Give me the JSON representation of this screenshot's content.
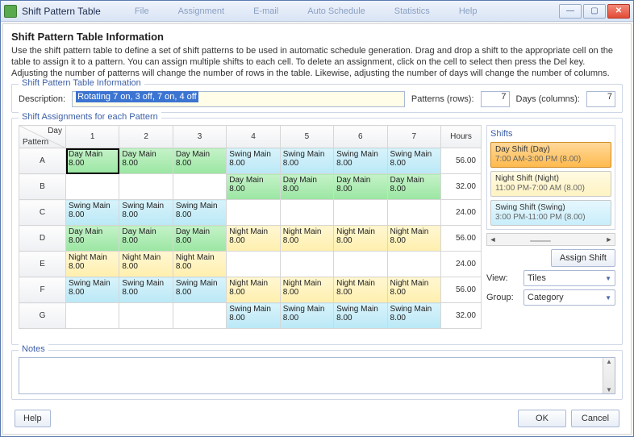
{
  "window": {
    "title": "Shift Pattern Table"
  },
  "menu_hints": [
    "File",
    "Assignment",
    "E-mail",
    "Auto Schedule",
    "Statistics",
    "Help"
  ],
  "heading": "Shift Pattern Table Information",
  "intro": "Use the shift pattern table to define a set of shift patterns to be used in automatic schedule generation. Drag and drop a shift to the appropriate cell on the table to assign it to a pattern. You can assign multiple shifts to each cell. To delete an assignment, click on the cell to select then press the Del key.  Adjusting the number of patterns will change the number of rows in the table. Likewise, adjusting the number of days will change the number of columns.",
  "info_box": {
    "legend": "Shift Pattern Table Information",
    "description_label": "Description:",
    "description_value": "Rotating 7 on, 3 off, 7 on, 4 off",
    "patterns_label": "Patterns (rows):",
    "patterns_value": "7",
    "days_label": "Days (columns):",
    "days_value": "7"
  },
  "assignments": {
    "legend": "Shift Assignments for each Pattern",
    "corner_day": "Day",
    "corner_pattern": "Pattern",
    "day_headers": [
      "1",
      "2",
      "3",
      "4",
      "5",
      "6",
      "7"
    ],
    "hours_header": "Hours",
    "rows": [
      {
        "label": "A",
        "hours": "56.00",
        "cells": [
          {
            "type": "day",
            "l1": "Day Main",
            "l2": "8.00",
            "selected": true
          },
          {
            "type": "day",
            "l1": "Day Main",
            "l2": "8.00"
          },
          {
            "type": "day",
            "l1": "Day Main",
            "l2": "8.00"
          },
          {
            "type": "swing",
            "l1": "Swing Main",
            "l2": "8.00"
          },
          {
            "type": "swing",
            "l1": "Swing Main",
            "l2": "8.00"
          },
          {
            "type": "swing",
            "l1": "Swing Main",
            "l2": "8.00"
          },
          {
            "type": "swing",
            "l1": "Swing Main",
            "l2": "8.00"
          }
        ]
      },
      {
        "label": "B",
        "hours": "32.00",
        "cells": [
          {
            "type": ""
          },
          {
            "type": ""
          },
          {
            "type": ""
          },
          {
            "type": "day",
            "l1": "Day Main",
            "l2": "8.00"
          },
          {
            "type": "day",
            "l1": "Day Main",
            "l2": "8.00"
          },
          {
            "type": "day",
            "l1": "Day Main",
            "l2": "8.00"
          },
          {
            "type": "day",
            "l1": "Day Main",
            "l2": "8.00"
          }
        ]
      },
      {
        "label": "C",
        "hours": "24.00",
        "cells": [
          {
            "type": "swing",
            "l1": "Swing Main",
            "l2": "8.00"
          },
          {
            "type": "swing",
            "l1": "Swing Main",
            "l2": "8.00"
          },
          {
            "type": "swing",
            "l1": "Swing Main",
            "l2": "8.00"
          },
          {
            "type": ""
          },
          {
            "type": ""
          },
          {
            "type": ""
          },
          {
            "type": ""
          }
        ]
      },
      {
        "label": "D",
        "hours": "56.00",
        "cells": [
          {
            "type": "day",
            "l1": "Day Main",
            "l2": "8.00"
          },
          {
            "type": "day",
            "l1": "Day Main",
            "l2": "8.00"
          },
          {
            "type": "day",
            "l1": "Day Main",
            "l2": "8.00"
          },
          {
            "type": "night",
            "l1": "Night Main",
            "l2": "8.00"
          },
          {
            "type": "night",
            "l1": "Night Main",
            "l2": "8.00"
          },
          {
            "type": "night",
            "l1": "Night Main",
            "l2": "8.00"
          },
          {
            "type": "night",
            "l1": "Night Main",
            "l2": "8.00"
          }
        ]
      },
      {
        "label": "E",
        "hours": "24.00",
        "cells": [
          {
            "type": "night",
            "l1": "Night Main",
            "l2": "8.00"
          },
          {
            "type": "night",
            "l1": "Night Main",
            "l2": "8.00"
          },
          {
            "type": "night",
            "l1": "Night Main",
            "l2": "8.00"
          },
          {
            "type": ""
          },
          {
            "type": ""
          },
          {
            "type": ""
          },
          {
            "type": ""
          }
        ]
      },
      {
        "label": "F",
        "hours": "56.00",
        "cells": [
          {
            "type": "swing",
            "l1": "Swing Main",
            "l2": "8.00"
          },
          {
            "type": "swing",
            "l1": "Swing Main",
            "l2": "8.00"
          },
          {
            "type": "swing",
            "l1": "Swing Main",
            "l2": "8.00"
          },
          {
            "type": "night",
            "l1": "Night Main",
            "l2": "8.00"
          },
          {
            "type": "night",
            "l1": "Night Main",
            "l2": "8.00"
          },
          {
            "type": "night",
            "l1": "Night Main",
            "l2": "8.00"
          },
          {
            "type": "night",
            "l1": "Night Main",
            "l2": "8.00"
          }
        ]
      },
      {
        "label": "G",
        "hours": "32.00",
        "cells": [
          {
            "type": ""
          },
          {
            "type": ""
          },
          {
            "type": ""
          },
          {
            "type": "swing",
            "l1": "Swing Main",
            "l2": "8.00"
          },
          {
            "type": "swing",
            "l1": "Swing Main",
            "l2": "8.00"
          },
          {
            "type": "swing",
            "l1": "Swing Main",
            "l2": "8.00"
          },
          {
            "type": "swing",
            "l1": "Swing Main",
            "l2": "8.00"
          }
        ]
      }
    ]
  },
  "shifts": {
    "legend": "Shifts",
    "items": [
      {
        "cls": "sel",
        "title": "Day Shift (Day)",
        "sub": "7:00 AM-3:00 PM (8.00)"
      },
      {
        "cls": "night",
        "title": "Night Shift (Night)",
        "sub": "11:00 PM-7:00 AM (8.00)"
      },
      {
        "cls": "swing",
        "title": "Swing Shift (Swing)",
        "sub": "3:00 PM-11:00 PM (8.00)"
      }
    ],
    "assign_btn": "Assign Shift",
    "view_label": "View:",
    "view_value": "Tiles",
    "group_label": "Group:",
    "group_value": "Category",
    "scroll_thumb": "|||"
  },
  "notes": {
    "legend": "Notes"
  },
  "footer": {
    "help": "Help",
    "ok": "OK",
    "cancel": "Cancel"
  }
}
